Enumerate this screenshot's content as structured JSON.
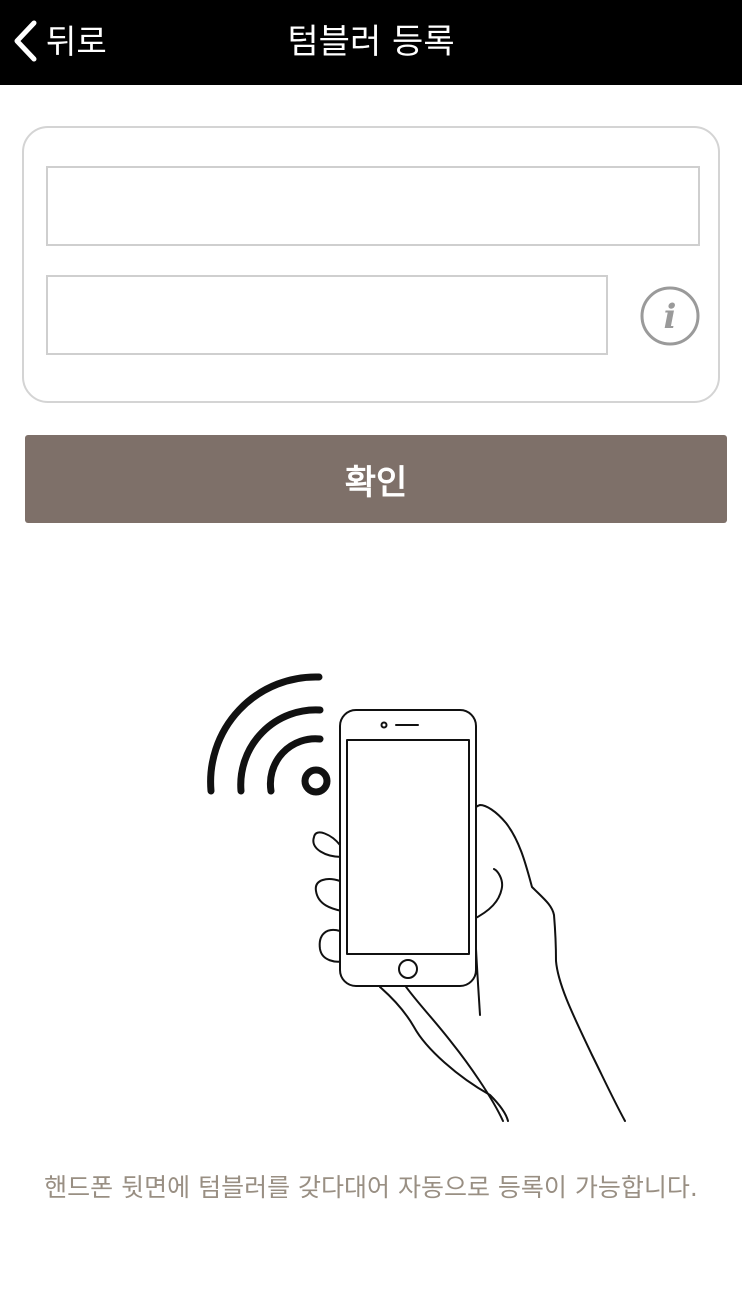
{
  "header": {
    "back_label": "뒤로",
    "title": "텀블러 등록",
    "icons": {
      "back": "chevron-left-icon"
    }
  },
  "form": {
    "field_1": {
      "value": "",
      "placeholder": ""
    },
    "field_2": {
      "value": "",
      "placeholder": ""
    },
    "info_icon": "info-icon",
    "info_glyph": "i"
  },
  "confirm": {
    "label": "확인"
  },
  "illustration": {
    "icon": "nfc-phone-tap-icon"
  },
  "caption": "핸드폰 뒷면에 텀블러를 갖다대어 자동으로 등록이 가능합니다.",
  "colors": {
    "header_bg": "#000000",
    "button_bg": "#7e7069",
    "caption_text": "#998f83",
    "border": "#d4d4d4"
  }
}
